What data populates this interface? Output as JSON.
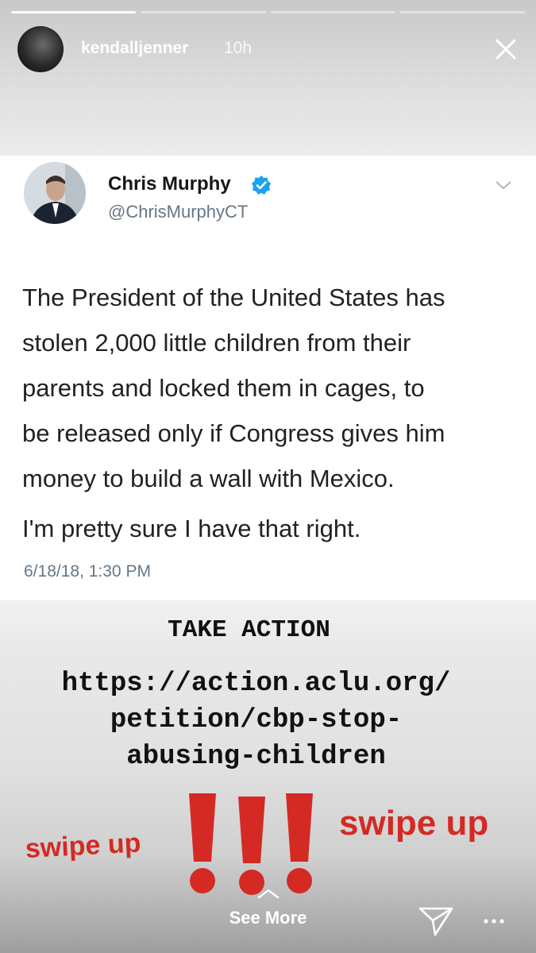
{
  "story": {
    "progress": [
      1.0,
      0.0,
      0.0,
      0.0
    ],
    "username": "kendalljenner",
    "time": "10h"
  },
  "tweet": {
    "name": "Chris Murphy",
    "handle": "@ChrisMurphyCT",
    "body_lines": [
      "The President of the United States has",
      "stolen 2,000 little children from their",
      "parents and locked them in cages, to",
      "be released only if Congress gives him",
      "money to build a wall with Mexico."
    ],
    "body_second": "I'm pretty sure I have that right.",
    "date": "6/18/18, 1:30 PM"
  },
  "overlay": {
    "take_action": "TAKE ACTION",
    "url_lines": [
      "https://action.aclu.org/",
      "petition/cbp-stop-",
      "abusing-children"
    ],
    "swipe_left": "swipe up",
    "swipe_right": "swipe up",
    "accent_color": "#d42a23"
  },
  "footer": {
    "see_more": "See More",
    "icons": [
      "chevron-up-icon",
      "send-icon",
      "more-icon"
    ]
  }
}
